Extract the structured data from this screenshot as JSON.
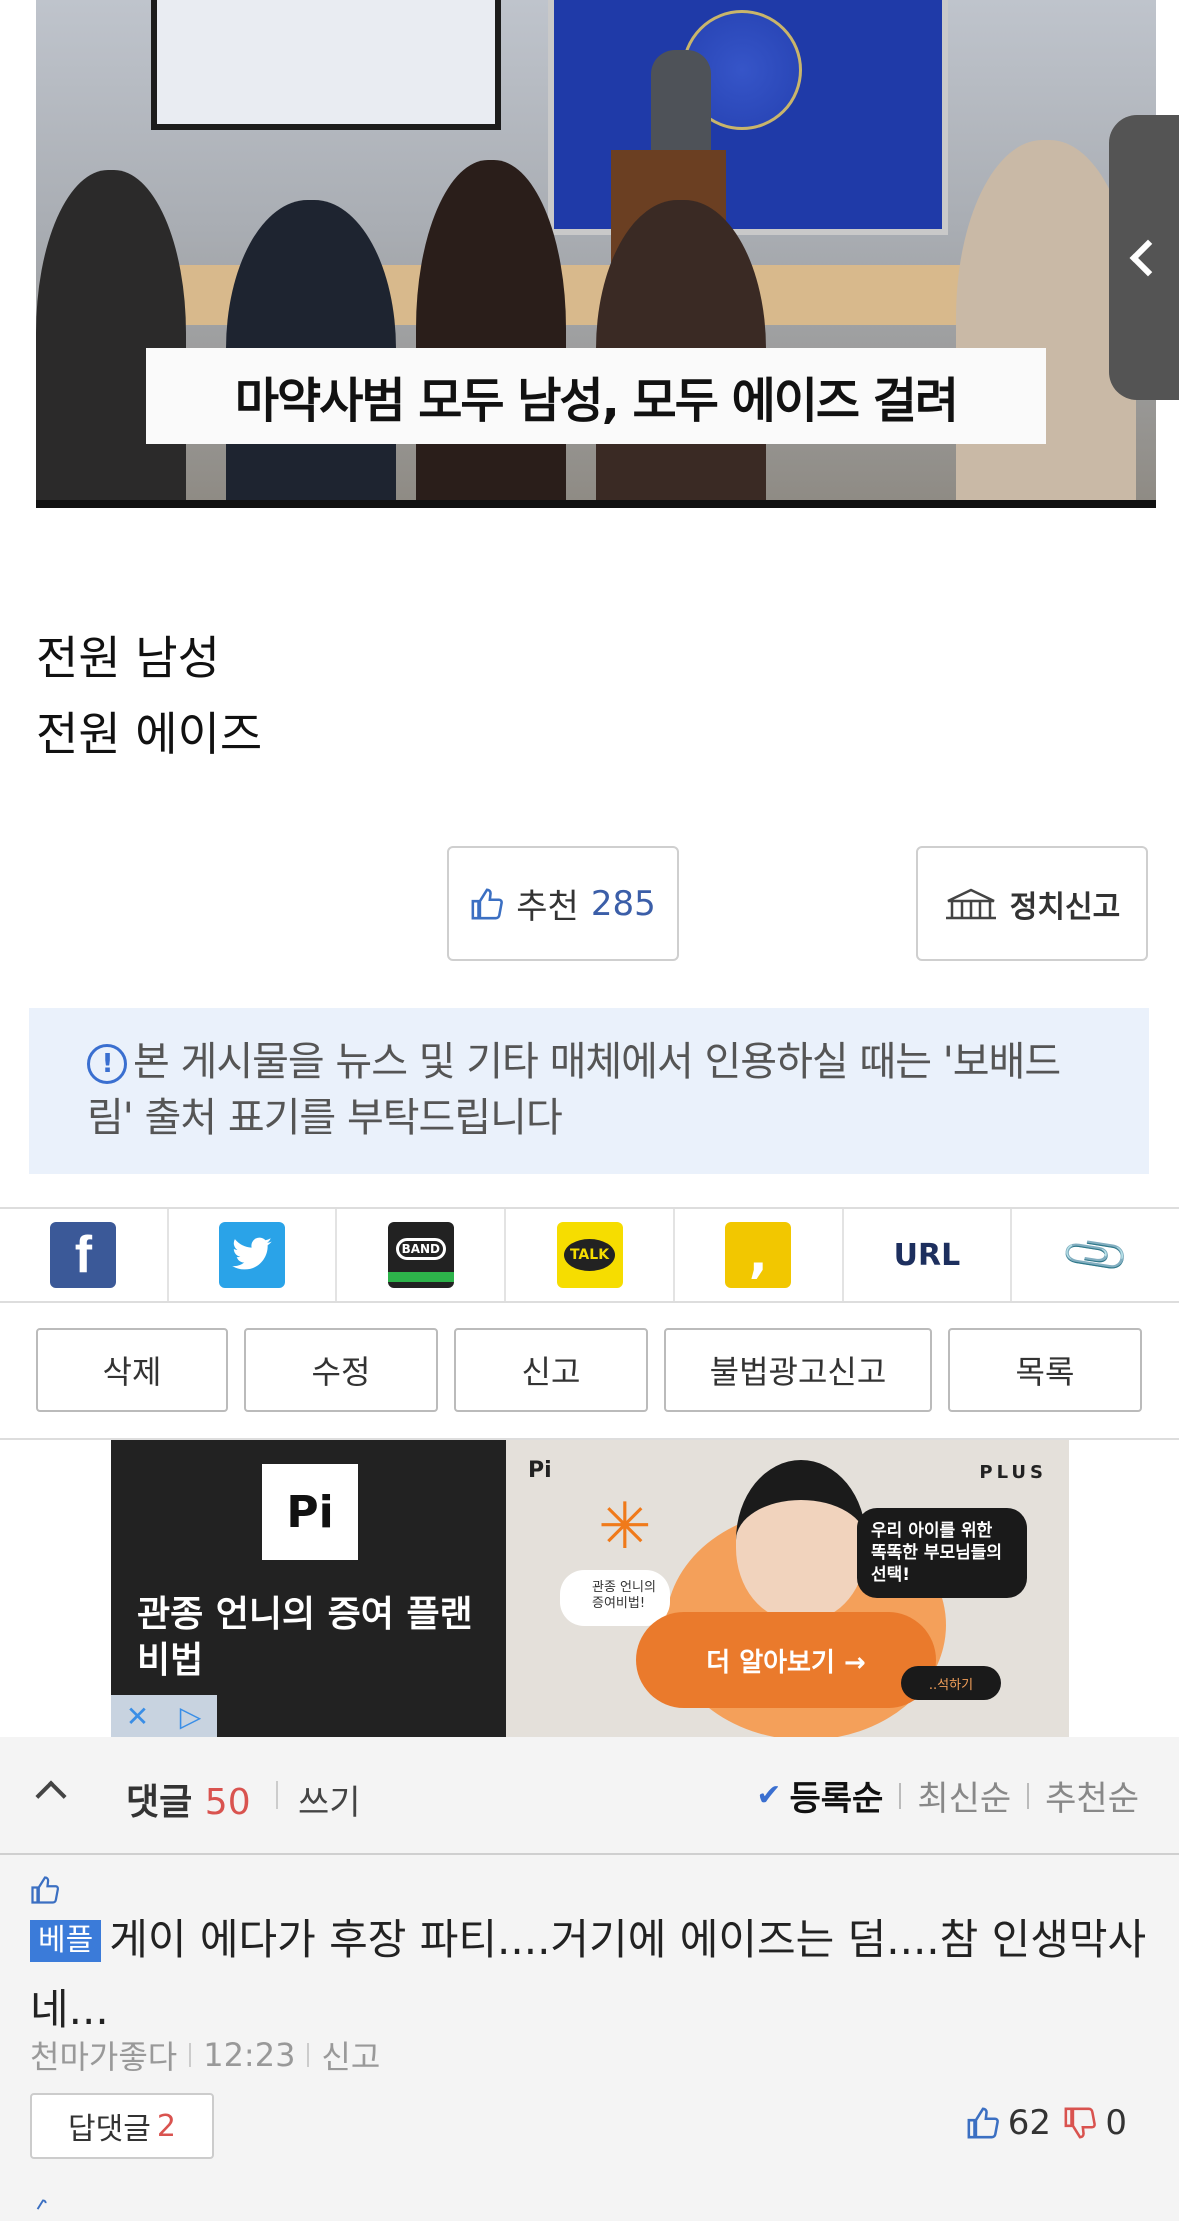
{
  "hero": {
    "caption": "마약사범 모두 남성, 모두 에이즈 걸려"
  },
  "post": {
    "lines": [
      "전원 남성",
      "전원 에이즈"
    ]
  },
  "recommend": {
    "label": "추천",
    "count": "285"
  },
  "political_report": {
    "label": "정치신고"
  },
  "notice": {
    "text": "본 게시물을 뉴스 및 기타 매체에서 인용하실 때는 '보배드림' 출처 표기를 부탁드립니다"
  },
  "share": {
    "items": [
      {
        "name": "facebook",
        "icon": "facebook-icon"
      },
      {
        "name": "twitter",
        "icon": "twitter-icon"
      },
      {
        "name": "band",
        "icon": "band-icon",
        "label": "BAND"
      },
      {
        "name": "kakaotalk",
        "icon": "kakaotalk-icon",
        "label": "TALK"
      },
      {
        "name": "kakaostory",
        "icon": "kakaostory-icon"
      },
      {
        "name": "url",
        "label": "URL"
      },
      {
        "name": "attach",
        "icon": "paperclip-icon"
      }
    ]
  },
  "actions": [
    {
      "label": "삭제"
    },
    {
      "label": "수정"
    },
    {
      "label": "신고"
    },
    {
      "label": "불법광고신고"
    },
    {
      "label": "목록"
    }
  ],
  "ad": {
    "logo": "Pi",
    "headline": "관종 언니의 증여 플랜 비법",
    "small_logo": "Pi",
    "brand": "PLUS",
    "bubble_left": "관종 언니의 증여비법!",
    "bubble_right": "우리 아이를 위한 똑똑한 부모님들의 선택!",
    "cta": "더 알아보기 →",
    "mini": "..석하기"
  },
  "comments_header": {
    "title": "댓글",
    "count": "50",
    "write": "쓰기",
    "sort": [
      "등록순",
      "최신순",
      "추천순"
    ],
    "active_sort": "등록순"
  },
  "comment": {
    "badge": "베플",
    "text": "게이 에다가 후장 파티....거기에 에이즈는 덤....참 인생막사네...",
    "author": "천마가좋다",
    "time": "12:23",
    "report": "신고",
    "reply_label": "답댓글",
    "reply_count": "2",
    "likes": "62",
    "dislikes": "0"
  },
  "colors": {
    "accent_blue": "#3b6fc2",
    "notice_bg": "#eaf1fb",
    "count_red": "#d9534f"
  }
}
